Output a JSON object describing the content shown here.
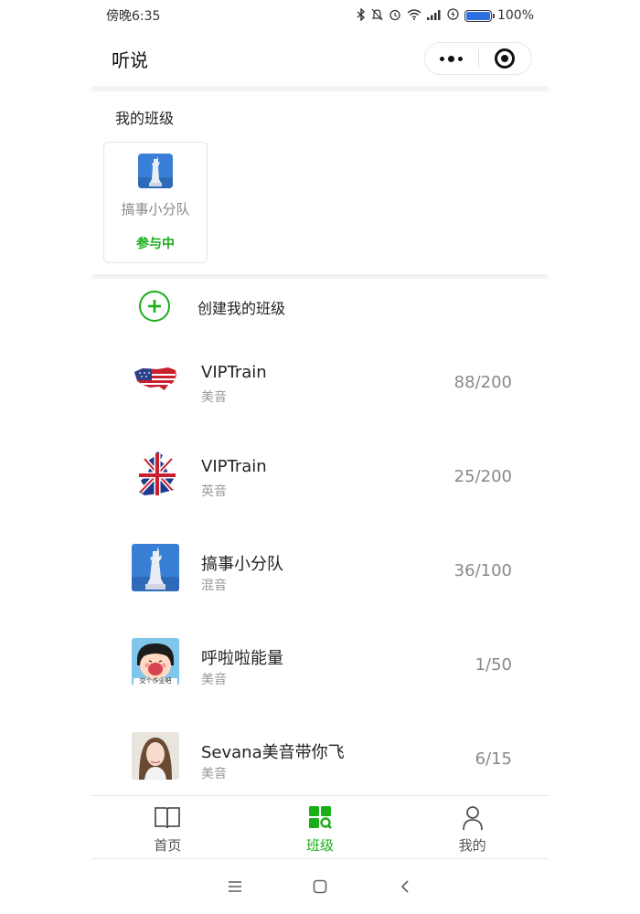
{
  "status_bar": {
    "time": "傍晚6:35",
    "battery": "100%",
    "battery_level": 1.0,
    "icons": [
      "bluetooth-icon",
      "mute-icon",
      "alarm-icon",
      "wifi-icon",
      "signal-icon",
      "charging-icon",
      "battery-icon"
    ]
  },
  "header": {
    "title": "听说",
    "menu_icon": "more-dots-icon",
    "close_icon": "target-circle-icon"
  },
  "my_class": {
    "title": "我的班级",
    "card": {
      "name": "搞事小分队",
      "status": "参与中",
      "thumb": "statue-of-liberty-image"
    }
  },
  "create": {
    "label": "创建我的班级",
    "icon": "plus-circle-icon"
  },
  "classes": [
    {
      "name": "VIPTrain",
      "accent": "美音",
      "count": "88/200",
      "avatar": "usa-flag-map-image"
    },
    {
      "name": "VIPTrain",
      "accent": "英音",
      "count": "25/200",
      "avatar": "uk-flag-map-image"
    },
    {
      "name": "搞事小分队",
      "accent": "混音",
      "count": "36/100",
      "avatar": "statue-of-liberty-image"
    },
    {
      "name": "呼啦啦能量",
      "accent": "美音",
      "count": "1/50",
      "avatar": "cartoon-girl-image",
      "avatar_caption": "交个作业吧"
    },
    {
      "name": "Sevana美音带你飞",
      "accent": "美音",
      "count": "6/15",
      "avatar": "woman-portrait-image"
    }
  ],
  "tabs": [
    {
      "label": "首页",
      "icon": "book-icon",
      "active": false
    },
    {
      "label": "班级",
      "icon": "grid-search-icon",
      "active": true
    },
    {
      "label": "我的",
      "icon": "person-icon",
      "active": false
    }
  ],
  "colors": {
    "accent_green": "#1aad19",
    "text_primary": "#222222",
    "text_secondary": "#999999",
    "battery_blue": "#2b6fe0"
  }
}
